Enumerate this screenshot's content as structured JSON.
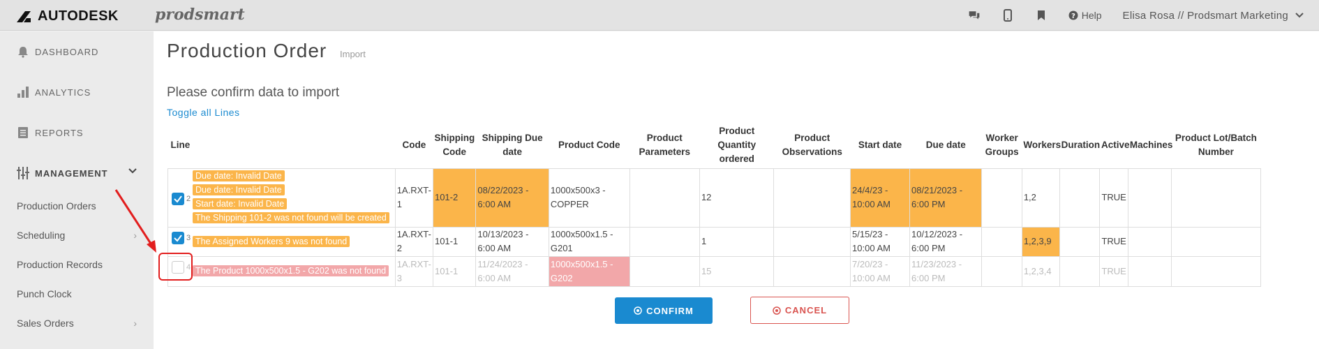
{
  "brand": {
    "autodesk": "AUTODESK",
    "prodsmart": "prodsmart"
  },
  "topbar": {
    "help_label": "Help",
    "user_label": "Elisa Rosa // Prodsmart Marketing",
    "icons": [
      "chat-icon",
      "mobile-icon",
      "bookmark-icon",
      "help-icon",
      "chevron-down-icon"
    ]
  },
  "sidebar": {
    "items": [
      {
        "label": "DASHBOARD",
        "icon": "bell-icon"
      },
      {
        "label": "ANALYTICS",
        "icon": "bar-chart-icon"
      },
      {
        "label": "REPORTS",
        "icon": "report-icon"
      },
      {
        "label": "MANAGEMENT",
        "icon": "management-icon"
      }
    ],
    "sub_items": [
      {
        "label": "Production Orders",
        "has_chevron": false
      },
      {
        "label": "Scheduling",
        "has_chevron": true
      },
      {
        "label": "Production Records",
        "has_chevron": false
      },
      {
        "label": "Punch Clock",
        "has_chevron": false
      },
      {
        "label": "Sales Orders",
        "has_chevron": true
      }
    ]
  },
  "page": {
    "title": "Production Order",
    "subtitle": "Import",
    "heading": "Please confirm data to import",
    "toggle_label": "Toggle all Lines"
  },
  "table": {
    "headers": {
      "line": "Line",
      "code": "Code",
      "shipping_code": "Shipping Code",
      "shipping_due": "Shipping Due date",
      "product_code": "Product Code",
      "product_params": "Product Parameters",
      "product_qty": "Product Quantity ordered",
      "product_obs": "Product Observations",
      "start_date": "Start date",
      "due_date": "Due date",
      "worker_groups": "Worker Groups",
      "workers": "Workers",
      "duration": "Duration",
      "active": "Active",
      "machines": "Machines",
      "lot": "Product Lot/Batch Number"
    },
    "rows": [
      {
        "line": "2",
        "checked": true,
        "tags": [
          "Due date: Invalid Date",
          "Due date: Invalid Date",
          "Start date: Invalid Date",
          "The Shipping 101-2 was not found will be created"
        ],
        "code": "1A.RXT-1",
        "shipping_code": "101-2",
        "shipping_due": "08/22/2023 - 6:00 AM",
        "product_code": "1000x500x3 - COPPER",
        "product_params": "",
        "product_qty": "12",
        "product_obs": "",
        "start_date": "24/4/23 - 10:00 AM",
        "due_date": "08/21/2023 - 6:00 PM",
        "worker_groups": "",
        "workers": "1,2",
        "duration": "",
        "active": "TRUE",
        "machines": "",
        "lot": ""
      },
      {
        "line": "3",
        "checked": true,
        "tags": [
          "The Assigned Workers 9 was not found"
        ],
        "code": "1A.RXT-2",
        "shipping_code": "101-1",
        "shipping_due": "10/13/2023 - 6:00 AM",
        "product_code": "1000x500x1.5 - G201",
        "product_params": "",
        "product_qty": "1",
        "product_obs": "",
        "start_date": "5/15/23 - 10:00 AM",
        "due_date": "10/12/2023 - 6:00 PM",
        "worker_groups": "",
        "workers": "1,2,3,9",
        "duration": "",
        "active": "TRUE",
        "machines": "",
        "lot": ""
      },
      {
        "line": "4",
        "checked": false,
        "tags": [
          "The Product 1000x500x1.5 - G202 was not found"
        ],
        "code": "1A.RXT-3",
        "shipping_code": "101-1",
        "shipping_due": "11/24/2023 - 6:00 AM",
        "product_code": "1000x500x1.5 - G202",
        "product_params": "",
        "product_qty": "15",
        "product_obs": "",
        "start_date": "7/20/23 - 10:00 AM",
        "due_date": "11/23/2023 - 6:00 PM",
        "worker_groups": "",
        "workers": "1,2,3,4",
        "duration": "",
        "active": "TRUE",
        "machines": "",
        "lot": ""
      }
    ]
  },
  "actions": {
    "confirm_label": "CONFIRM",
    "cancel_label": "CANCEL"
  },
  "colors": {
    "accent": "#1a8ad0",
    "warning": "#fbb54a",
    "error": "#f2a7a9",
    "cancel": "#d9534f",
    "annotation": "#e21e1e"
  }
}
